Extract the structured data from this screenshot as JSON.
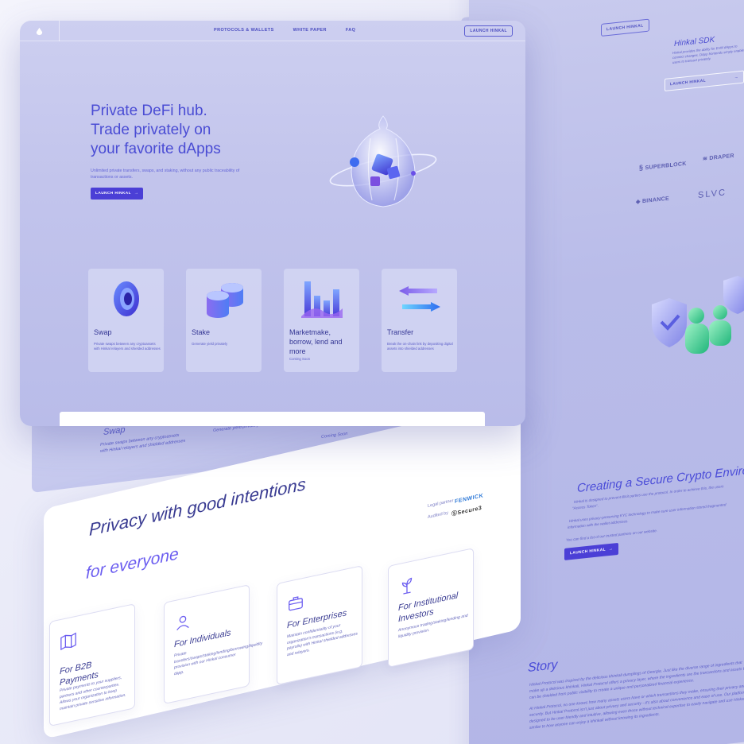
{
  "nav": {
    "links": [
      "PROTOCOLS & WALLETS",
      "WHITE PAPER",
      "FAQ"
    ],
    "cta": "LAUNCH HINKAL"
  },
  "hero": {
    "title_line1": "Private DeFi hub.",
    "title_line2": "Trade privately on",
    "title_line3": "your favorite dApps",
    "subtitle": "Unlimited private transfers, swaps, and staking, without any public traceability of transactions or assets.",
    "button": "LAUNCH HINKAL",
    "button_arrow": "→"
  },
  "features": [
    {
      "title": "Swap",
      "desc": "Private swaps between any cryptoassets with Hinkal relayers and shielded addresses"
    },
    {
      "title": "Stake",
      "desc": "Generate yield privately"
    },
    {
      "title": "Marketmake, borrow, lend and more",
      "desc": "Coming Soon"
    },
    {
      "title": "Transfer",
      "desc": "Break the on-chain link by depositing digital assets into shielded addresses"
    }
  ],
  "ghost": {
    "swap_title": "Swap",
    "swap_desc": "Private swaps between any cryptoassets with Hinkal relayers and shielded addresses",
    "stake_desc": "Generate yield privately",
    "coming": "Coming Soon"
  },
  "privacy": {
    "title": "Privacy with good intentions",
    "subtitle": "for everyone",
    "legal_label": "Legal partner",
    "legal_name": "FENWICK",
    "audit_label": "Audited by",
    "audit_name": "Secure3",
    "cards": [
      {
        "title": "For B2B Payments",
        "desc": "Private payments to your suppliers, partners and other counterparties. Allows your organization to keep maintain private sensitive information."
      },
      {
        "title": "For Individuals",
        "desc": "Private transfers/swaps/staking/lending/borrowing/liquidity provision with our Hinkal consumer dapp."
      },
      {
        "title": "For Enterprises",
        "desc": "Maintain confidentiality of your organization's transactions (e.g. payrolls) with Hinkal shielded addresses and relayers."
      },
      {
        "title": "For Institutional Investors",
        "desc": "Anonymous trading/staking/lending and liquidity provision."
      }
    ]
  },
  "right": {
    "launch": "LAUNCH HINKAL",
    "sdk_title": "Hinkal SDK",
    "sdk_desc": "Hinkal provides the ability for EVM dApps to connect changes. DApp frontends simply enable users to transact privately.",
    "sdk_button": "LAUNCH HINKAL",
    "sdk_arrow": "→",
    "partners": [
      "SUPERBLOCK",
      "DRAPER",
      "BINANCE",
      "SLVC"
    ],
    "secure_title": "Creating a Secure Crypto Environment",
    "secure_p1": "Hinkal is designed to prevent illicit parties use the protocol. In order to achieve this, the users",
    "secure_p1b": "\"Access Token\".",
    "secure_p2": "Hinkal uses privacy-preserving KYC technology to make sure user information stored fragmented",
    "secure_p2b": "information with the wallet addresses.",
    "secure_p3": "You can find a list of our trusted partners on our website.",
    "secure_button": "LAUNCH HINKAL",
    "story_title": "Story",
    "story_p1": "Hinkal Protocol was inspired by the delicious khinkali dumplings of Georgia. Just like the diverse range of ingredients that make up a delicious khinkali, Hinkal Protocol offers a privacy layer, where the ingredients are the transactions and assets that can be shielded from public visibility to create a unique and personalized financial experience.",
    "story_p2": "At Hinkal Protocol, no one knows how many assets users have or which transactions they make, ensuring their privacy and security. But Hinkal Protocol isn't just about privacy and security - it's also about convenience and ease of use. Our platform is designed to be user-friendly and intuitive, allowing even those without technical expertise to easily navigate and use Hinkal, similar to how anyone can enjoy a khinkali without knowing its ingredients."
  }
}
